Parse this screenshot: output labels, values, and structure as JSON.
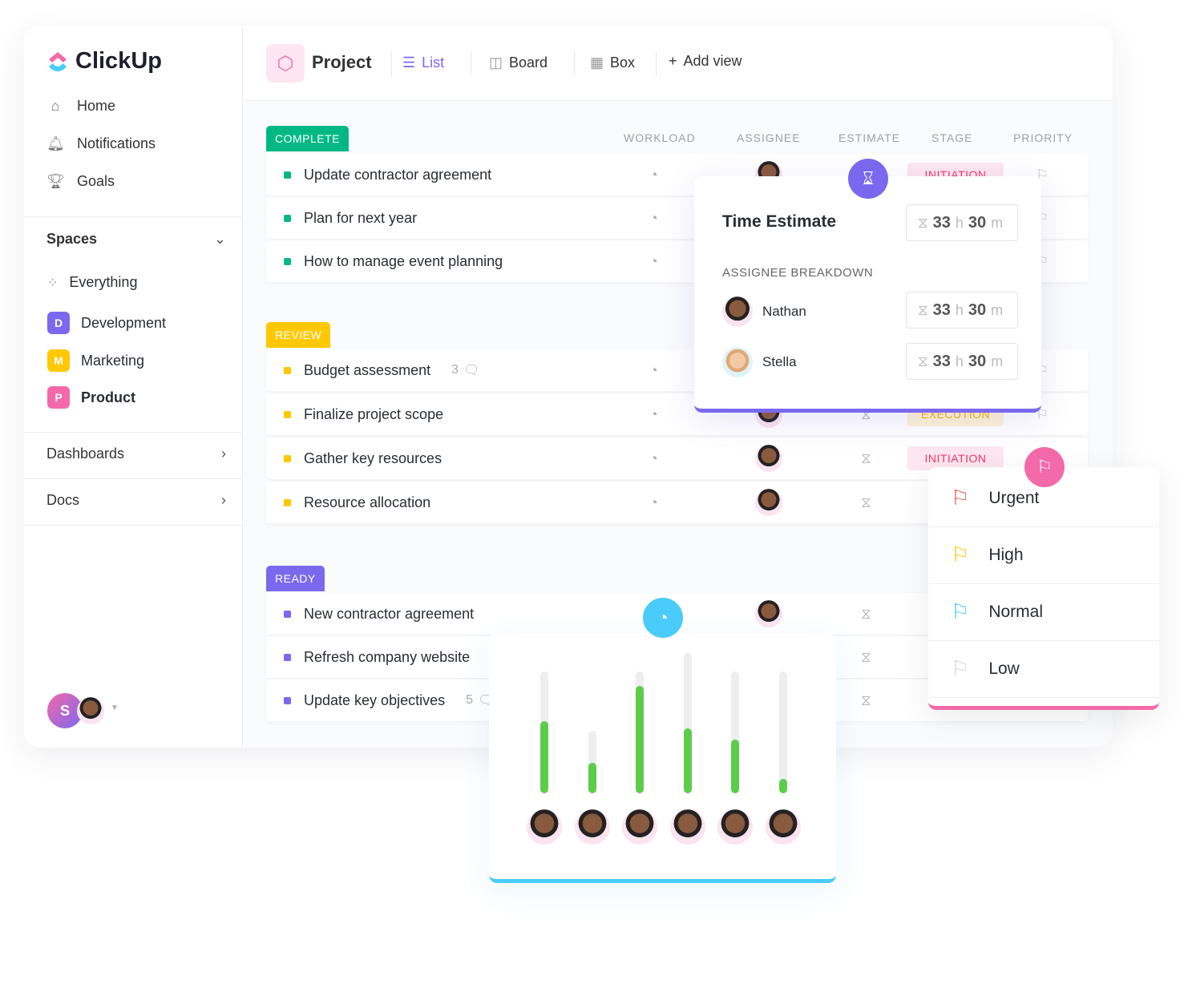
{
  "brand": {
    "name": "ClickUp"
  },
  "sidebar": {
    "nav": [
      {
        "label": "Home",
        "icon": "home-icon"
      },
      {
        "label": "Notifications",
        "icon": "bell-icon"
      },
      {
        "label": "Goals",
        "icon": "trophy-icon"
      }
    ],
    "spaces_label": "Spaces",
    "everything_label": "Everything",
    "spaces": [
      {
        "letter": "D",
        "label": "Development",
        "color": "#7b68ee"
      },
      {
        "letter": "M",
        "label": "Marketing",
        "color": "#ffc800"
      },
      {
        "letter": "P",
        "label": "Product",
        "color": "#f469a9"
      }
    ],
    "dashboards_label": "Dashboards",
    "docs_label": "Docs",
    "user_initial": "S"
  },
  "header": {
    "project": "Project",
    "views": [
      {
        "label": "List",
        "active": true
      },
      {
        "label": "Board"
      },
      {
        "label": "Box"
      }
    ],
    "add_view": "Add view"
  },
  "columns": [
    "WORKLOAD",
    "ASSIGNEE",
    "ESTIMATE",
    "STAGE",
    "PRIORITY"
  ],
  "groups": [
    {
      "label": "COMPLETE",
      "color": "#00b884",
      "tasks": [
        {
          "name": "Update contractor agreement",
          "stage": "INITIATION"
        },
        {
          "name": "Plan for next year"
        },
        {
          "name": "How to manage event planning"
        }
      ]
    },
    {
      "label": "REVIEW",
      "color": "#ffc800",
      "tasks": [
        {
          "name": "Budget assessment",
          "comments": "3"
        },
        {
          "name": "Finalize project scope",
          "stage": "EXECUTION"
        },
        {
          "name": "Gather key resources",
          "stage": "INITIATION"
        },
        {
          "name": "Resource allocation"
        }
      ]
    },
    {
      "label": "READY",
      "color": "#7b68ee",
      "tasks": [
        {
          "name": "New contractor agreement"
        },
        {
          "name": "Refresh company website"
        },
        {
          "name": "Update key objectives",
          "comments": "5"
        }
      ]
    }
  ],
  "time_estimate": {
    "title": "Time Estimate",
    "total": {
      "h": "33",
      "m": "30"
    },
    "breakdown_label": "ASSIGNEE BREAKDOWN",
    "h_unit": "h",
    "m_unit": "m",
    "assignees": [
      {
        "name": "Nathan",
        "h": "33",
        "m": "30"
      },
      {
        "name": "Stella",
        "h": "33",
        "m": "30"
      }
    ]
  },
  "priority": {
    "options": [
      {
        "label": "Urgent",
        "color": "#f0584f"
      },
      {
        "label": "High",
        "color": "#ffc800"
      },
      {
        "label": "Normal",
        "color": "#49ccf9"
      },
      {
        "label": "Low",
        "color": "#d5d8de"
      }
    ]
  },
  "workload": {
    "bars": [
      {
        "track": 1.0,
        "fill": 0.59
      },
      {
        "track": 0.51,
        "fill": 0.25
      },
      {
        "track": 1.0,
        "fill": 0.88
      },
      {
        "track": 1.15,
        "fill": 0.53
      },
      {
        "track": 1.0,
        "fill": 0.44
      },
      {
        "track": 1.0,
        "fill": 0.12
      }
    ]
  }
}
